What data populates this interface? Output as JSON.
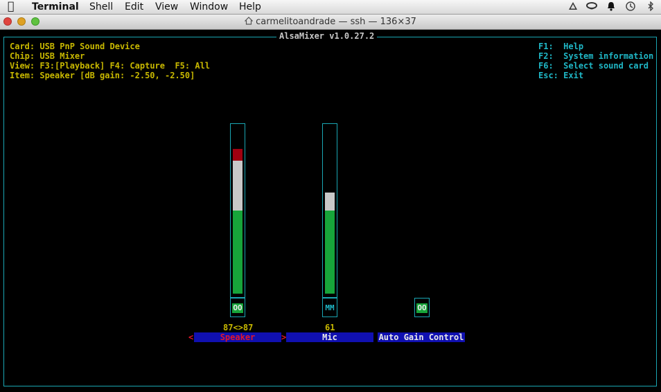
{
  "menubar": {
    "app_name": "Terminal",
    "menus": [
      "Shell",
      "Edit",
      "View",
      "Window",
      "Help"
    ],
    "tray_icons": [
      "drive-icon",
      "cup-icon",
      "bell-icon",
      "time-machine-icon",
      "bluetooth-icon"
    ]
  },
  "window": {
    "title": "carmelitoandrade — ssh — 136×37"
  },
  "alsamixer": {
    "title": "AlsaMixer v1.0.27.2",
    "info": {
      "card_label": "Card:",
      "card_value": "USB PnP Sound Device",
      "chip_label": "Chip:",
      "chip_value": "USB Mixer",
      "view_label": "View:",
      "view_f3": "F3:[Playback]",
      "view_f4": "F4: Capture",
      "view_f5": "F5: All",
      "item_label": "Item:",
      "item_value": "Speaker [dB gain: -2.50, -2.50]"
    },
    "help": [
      {
        "key": "F1:",
        "text": "Help"
      },
      {
        "key": "F2:",
        "text": "System information"
      },
      {
        "key": "F6:",
        "text": "Select sound card"
      },
      {
        "key": "Esc:",
        "text": "Exit"
      }
    ],
    "channels": [
      {
        "name": "Speaker",
        "value_text": "87<>87",
        "level_percent": 87,
        "switch": "OO",
        "selected": true
      },
      {
        "name": "Mic",
        "value_text": "61",
        "level_percent": 61,
        "switch": "MM",
        "selected": false
      },
      {
        "name": "Auto Gain Control",
        "switch": "OO",
        "selected": false
      }
    ],
    "selection_arrows": [
      "<",
      ">"
    ]
  },
  "colors": {
    "frame": "#1aa7b4",
    "info_text": "#c8b800",
    "meter_low": "#17a53a",
    "meter_mid": "#c8c8c8",
    "meter_high": "#a00010",
    "name_bar": "#1010b0",
    "selected_name": "#e2162c"
  }
}
